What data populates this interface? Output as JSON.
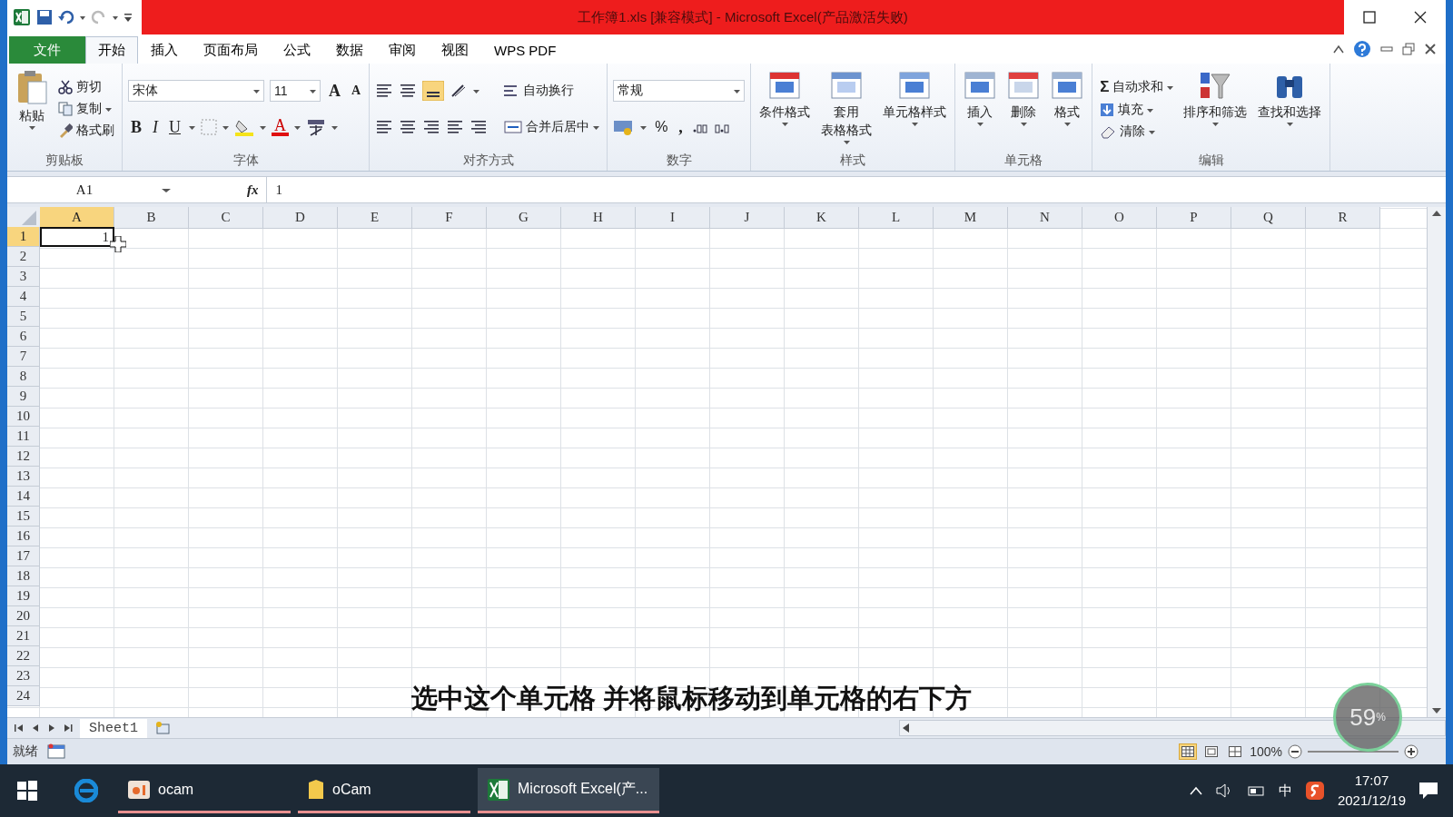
{
  "window": {
    "title": "工作簿1.xls  [兼容模式] - Microsoft Excel(产品激活失败)"
  },
  "ribbon_tabs": [
    {
      "label": "文件",
      "kind": "file",
      "selected": false
    },
    {
      "label": "开始",
      "kind": "tab",
      "selected": true
    },
    {
      "label": "插入",
      "kind": "tab",
      "selected": false
    },
    {
      "label": "页面布局",
      "kind": "tab",
      "selected": false
    },
    {
      "label": "公式",
      "kind": "tab",
      "selected": false
    },
    {
      "label": "数据",
      "kind": "tab",
      "selected": false
    },
    {
      "label": "审阅",
      "kind": "tab",
      "selected": false
    },
    {
      "label": "视图",
      "kind": "tab",
      "selected": false
    },
    {
      "label": "WPS PDF",
      "kind": "tab",
      "selected": false
    }
  ],
  "ribbon_groups": [
    {
      "kind": "clipboard",
      "label": "剪贴板",
      "large": [
        {
          "lines": [
            "粘贴"
          ]
        }
      ],
      "small": [
        {
          "label": "剪切"
        },
        {
          "label": "复制"
        },
        {
          "label": "格式刷"
        }
      ]
    },
    {
      "kind": "font",
      "label": "字体",
      "font": "宋体",
      "size": "11",
      "grow": "A",
      "shrink": "A",
      "styles": [
        "B",
        "I",
        "U"
      ],
      "font_color": "A"
    },
    {
      "kind": "alignment",
      "label": "对齐方式",
      "wrap": "自动换行",
      "merge": "合并后居中"
    },
    {
      "kind": "number",
      "label": "数字",
      "format": "常规",
      "percent": "%",
      "comma": ","
    },
    {
      "kind": "styles",
      "label": "样式",
      "large": [
        {
          "lines": [
            "条件格式"
          ]
        },
        {
          "lines": [
            "套用",
            "表格格式"
          ]
        },
        {
          "lines": [
            "单元格样式"
          ]
        }
      ]
    },
    {
      "kind": "cells",
      "label": "单元格",
      "large": [
        {
          "lines": [
            "插入"
          ]
        },
        {
          "lines": [
            "删除"
          ]
        },
        {
          "lines": [
            "格式"
          ]
        }
      ]
    },
    {
      "kind": "editing",
      "label": "编辑",
      "sigma": "Σ",
      "small": [
        {
          "label": "自动求和"
        },
        {
          "label": "填充"
        },
        {
          "label": "清除"
        }
      ],
      "large": [
        {
          "lines": [
            "排序和筛选"
          ]
        },
        {
          "lines": [
            "查找和选择"
          ]
        }
      ]
    }
  ],
  "formula_bar": {
    "name_box": "A1",
    "fx": "fx",
    "value": "1"
  },
  "sheet": {
    "columns": [
      {
        "label": "A",
        "selected": true
      },
      {
        "label": "B",
        "selected": false
      },
      {
        "label": "C",
        "selected": false
      },
      {
        "label": "D",
        "selected": false
      },
      {
        "label": "E",
        "selected": false
      },
      {
        "label": "F",
        "selected": false
      },
      {
        "label": "G",
        "selected": false
      },
      {
        "label": "H",
        "selected": false
      },
      {
        "label": "I",
        "selected": false
      },
      {
        "label": "J",
        "selected": false
      },
      {
        "label": "K",
        "selected": false
      },
      {
        "label": "L",
        "selected": false
      },
      {
        "label": "M",
        "selected": false
      },
      {
        "label": "N",
        "selected": false
      },
      {
        "label": "O",
        "selected": false
      },
      {
        "label": "P",
        "selected": false
      },
      {
        "label": "Q",
        "selected": false
      },
      {
        "label": "R",
        "selected": false
      }
    ],
    "rows": [
      {
        "label": "1",
        "selected": true,
        "cells": [
          {
            "value": "1",
            "selected": true
          }
        ]
      },
      {
        "label": "2",
        "selected": false
      },
      {
        "label": "3",
        "selected": false
      },
      {
        "label": "4",
        "selected": false
      },
      {
        "label": "5",
        "selected": false
      },
      {
        "label": "6",
        "selected": false
      },
      {
        "label": "7",
        "selected": false
      },
      {
        "label": "8",
        "selected": false
      },
      {
        "label": "9",
        "selected": false
      },
      {
        "label": "10",
        "selected": false
      },
      {
        "label": "11",
        "selected": false
      },
      {
        "label": "12",
        "selected": false
      },
      {
        "label": "13",
        "selected": false
      },
      {
        "label": "14",
        "selected": false
      },
      {
        "label": "15",
        "selected": false
      },
      {
        "label": "16",
        "selected": false
      },
      {
        "label": "17",
        "selected": false
      },
      {
        "label": "18",
        "selected": false
      },
      {
        "label": "19",
        "selected": false
      },
      {
        "label": "20",
        "selected": false
      },
      {
        "label": "21",
        "selected": false
      },
      {
        "label": "22",
        "selected": false
      },
      {
        "label": "23",
        "selected": false
      },
      {
        "label": "24",
        "selected": false
      }
    ]
  },
  "sheet_tabs": [
    {
      "label": "Sheet1",
      "selected": true
    }
  ],
  "caption": "选中这个单元格 并将鼠标移动到单元格的右下方",
  "status_bar": {
    "text": "就绪",
    "zoom": "100%",
    "views": [
      {
        "kind": "normal",
        "selected": true
      },
      {
        "kind": "page_layout",
        "selected": false
      },
      {
        "kind": "page_break",
        "selected": false
      }
    ]
  },
  "gauge": {
    "value": "59",
    "unit": "%"
  },
  "taskbar": {
    "items": [
      {
        "label": "ocam",
        "kind": "app",
        "selected": false
      },
      {
        "label": "oCam",
        "kind": "folder",
        "selected": false
      },
      {
        "label": "Microsoft Excel(产...",
        "kind": "excel",
        "selected": true
      }
    ],
    "ime": "中",
    "time": "17:07",
    "date": "2021/12/19"
  }
}
